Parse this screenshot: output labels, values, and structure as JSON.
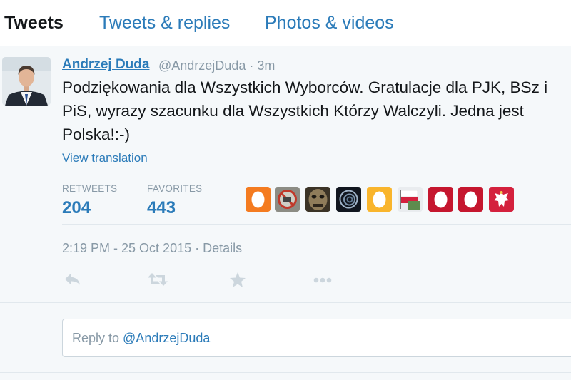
{
  "tabs": {
    "tweets": "Tweets",
    "replies": "Tweets & replies",
    "photos": "Photos & videos"
  },
  "tweet": {
    "author_name": "Andrzej Duda",
    "handle": "@AndrzejDuda",
    "age": "3m",
    "text": "Podziękowania dla Wszystkich Wyborców. Gratulacje dla PJK, BSz i PiS, wyrazy szacunku dla Wszystkich Którzy Walczyli. Jedna jest Polska!:-)",
    "translate_link": "View translation",
    "timestamp": "2:19 PM - 25 Oct 2015",
    "details_link": "Details"
  },
  "stats": {
    "retweets_label": "RETWEETS",
    "retweets_value": "204",
    "favorites_label": "FAVORITES",
    "favorites_value": "443"
  },
  "actions": [
    "reply-icon",
    "retweet-icon",
    "favorite-icon",
    "more-icon"
  ],
  "reply": {
    "prefix": "Reply to ",
    "mention": "@AndrzejDuda"
  },
  "colors": {
    "link": "#2b7bb9",
    "muted": "#8899a6",
    "text": "#14171a",
    "background": "#f5f8fa"
  }
}
